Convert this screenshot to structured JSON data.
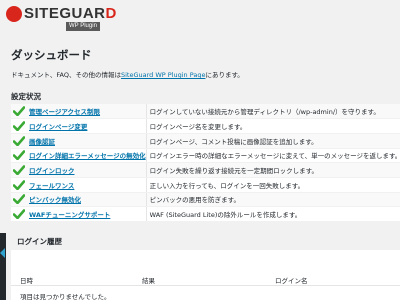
{
  "logo": {
    "main_prefix": "SITEGUAR",
    "main_accent": "D",
    "sub": "WP Plugin",
    "brand_color": "#d9261c"
  },
  "page": {
    "title": "ダッシュボード"
  },
  "doc": {
    "before": "ドキュメント、FAQ、その他の情報は",
    "link": "SiteGuard WP Plugin Page",
    "after": "にあります。"
  },
  "settings": {
    "title": "設定状況",
    "check_icon": "checkmark-icon",
    "check_color": "#3aaa35",
    "rows": [
      {
        "feature": "管理ページアクセス制限",
        "desc": "ログインしていない接続元から管理ディレクトリ（/wp-admin/）を守ります。"
      },
      {
        "feature": "ログインページ変更",
        "desc": "ログインページ名を変更します。"
      },
      {
        "feature": "画像認証",
        "desc": "ログインページ、コメント投稿に画像認証を追加します。"
      },
      {
        "feature": "ログイン詳細エラーメッセージの無効化",
        "desc": "ログインエラー時の詳細なエラーメッセージに変えて、単一のメッセージを返します。"
      },
      {
        "feature": "ログインロック",
        "desc": "ログイン失敗を繰り返す接続元を一定期間ロックします。"
      },
      {
        "feature": "フェールワンス",
        "desc": "正しい入力を行っても、ログインを一回失敗します。"
      },
      {
        "feature": "ピンバック無効化",
        "desc": "ピンバックの悪用を防ぎます。"
      },
      {
        "feature": "WAFチューニングサポート",
        "desc": "WAF (SiteGuard Lite)の除外ルールを作成します。"
      }
    ]
  },
  "history": {
    "title": "ログイン履歴",
    "columns": [
      "日時",
      "結果",
      "ログイン名"
    ],
    "empty": "項目は見つかりませんでした。"
  }
}
